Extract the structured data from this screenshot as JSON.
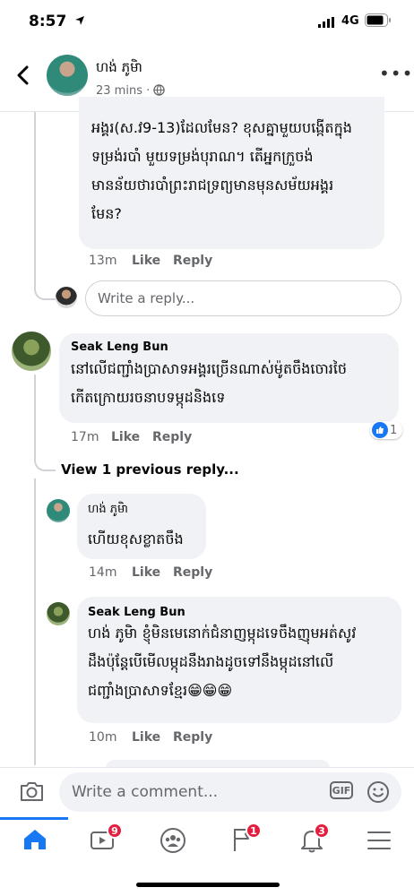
{
  "status_bar": {
    "time": "8:57",
    "network": "4G"
  },
  "header": {
    "name": "ហង់ ភូមិា",
    "time": "23 mins ·"
  },
  "thread": {
    "comment1": {
      "text": "អង្គរ(ស.វ9-13)ដែលមែន? ខុសគ្នាមួយបង្កើតក្នុង\nទម្រង់របាំ មួយទម្រង់បុរាណ។ តើអ្នកក្រួចង់\nមានន័យថារបាំព្រះរាជទ្រព្យមានមុនសម័យអង្គរ\nមែន?",
      "time": "13m",
      "like": "Like",
      "reply": "Reply"
    },
    "reply_placeholder": "Write a reply...",
    "comment2": {
      "author": "Seak Leng Bun",
      "text": "នៅលើជញ្ជាំងប្រាសាទអង្គរច្រើនណាស់ម៉ូតចឹងចោរថៃ\nកើតក្រោយរចនាបទម្កុដនិងទេ",
      "time": "17m",
      "like": "Like",
      "reply": "Reply",
      "like_count": "1"
    },
    "view_previous": "View 1 previous reply...",
    "reply1": {
      "author": "ហង់ ភូមិា",
      "text": "ហើយខុសខ្លាតចឹង",
      "time": "14m",
      "like": "Like",
      "reply": "Reply"
    },
    "reply2": {
      "author": "Seak Leng Bun",
      "text": "ហង់ ភូមិា ខ្ញុំមិនមេនោក់ជំនាញម្កុដទេចឹងញុមអត់សូវ\nដឹងប៉ុន្តែបើមើលម្កុដនឹងរាងដូចទៅនឹងម្កុដនៅលើ\nជញ្ជាំងប្រាសាទខ្មែរ😁😁😁",
      "time": "10m",
      "like": "Like",
      "reply": "Reply"
    }
  },
  "composer": {
    "placeholder": "Write a comment...",
    "gif": "GIF"
  },
  "nav": {
    "watch_badge": "9",
    "pages_badge": "1",
    "notifications_badge": "3"
  },
  "colors": {
    "accent": "#1877f2",
    "badge": "#e41e3f"
  }
}
